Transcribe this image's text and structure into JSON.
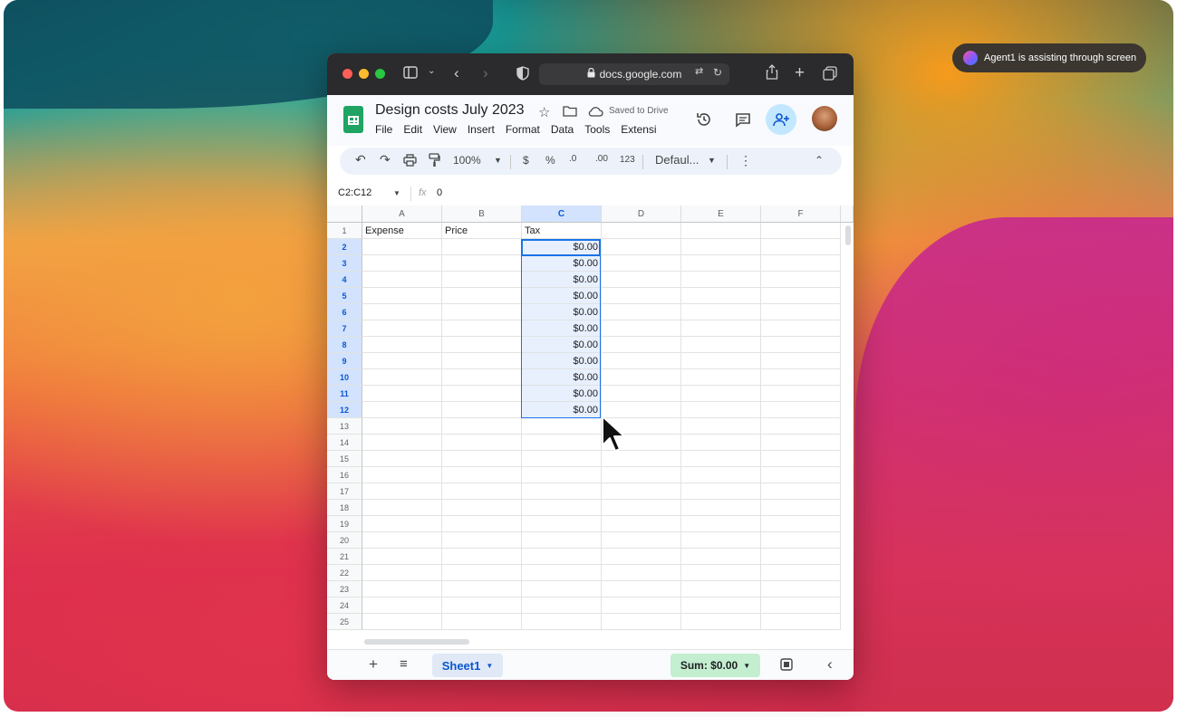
{
  "agent_banner": {
    "text": "Agent1 is assisting through screen"
  },
  "browser": {
    "url": "docs.google.com",
    "lock_icon": "lock-icon",
    "traffic_lights": [
      "#ff5f57",
      "#febc2e",
      "#28c840"
    ]
  },
  "document": {
    "title": "Design costs July 2023",
    "saved_status": "Saved to Drive",
    "menu": [
      "File",
      "Edit",
      "View",
      "Insert",
      "Format",
      "Data",
      "Tools",
      "Extensi"
    ]
  },
  "toolbar": {
    "zoom": "100%",
    "currency": "$",
    "percent": "%",
    "decrease_decimals": ".0",
    "increase_decimals": ".00",
    "number_format": "123",
    "font": "Defaul..."
  },
  "formula_bar": {
    "name_box": "C2:C12",
    "fx_symbol": "fx",
    "value": "0"
  },
  "sheet": {
    "columns": [
      "A",
      "B",
      "C",
      "D",
      "E",
      "F"
    ],
    "selected_column": "C",
    "rows": [
      "1",
      "2",
      "3",
      "4",
      "5",
      "6",
      "7",
      "8",
      "9",
      "10",
      "11",
      "12",
      "13",
      "14",
      "15",
      "16",
      "17",
      "18",
      "19",
      "20",
      "21",
      "22",
      "23",
      "24",
      "25"
    ],
    "headers": {
      "A": "Expense",
      "B": "Price",
      "C": "Tax"
    },
    "tax_values": [
      "$0.00",
      "$0.00",
      "$0.00",
      "$0.00",
      "$0.00",
      "$0.00",
      "$0.00",
      "$0.00",
      "$0.00",
      "$0.00",
      "$0.00"
    ]
  },
  "bottom_bar": {
    "sheet_tab": "Sheet1",
    "sum_label": "Sum: $0.00"
  },
  "colors": {
    "selection_blue": "#1a73e8",
    "sheets_green": "#1fa463",
    "sum_green": "#c4eed0"
  }
}
